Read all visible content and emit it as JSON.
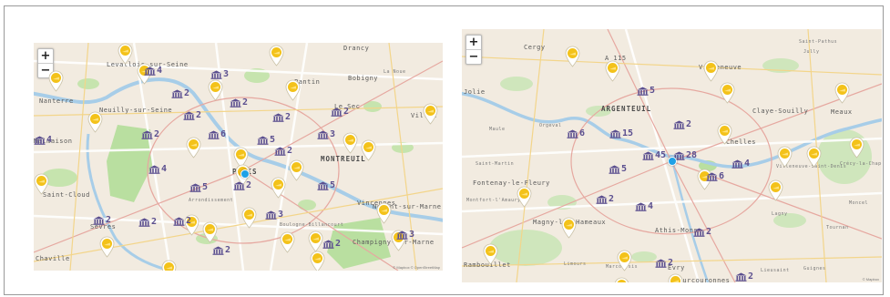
{
  "accent": {
    "marker_yellow": "#f3c21a",
    "museum_purple": "#5b4f8f",
    "you_dot": "#1ea1e6",
    "park_green": "#b9dfa0"
  },
  "zoom": {
    "in_label": "+",
    "out_label": "−"
  },
  "map1": {
    "places": [
      {
        "text": "Drancy",
        "cls": ""
      },
      {
        "text": "Bobigny",
        "cls": ""
      },
      {
        "text": "La Noue",
        "cls": "tiny"
      },
      {
        "text": "Pantin",
        "cls": ""
      },
      {
        "text": "Nanterre",
        "cls": ""
      },
      {
        "text": "Neuilly-sur-Seine",
        "cls": ""
      },
      {
        "text": "Levallois-sur-Seine",
        "cls": ""
      },
      {
        "text": "Malmaison",
        "cls": ""
      },
      {
        "text": "PARIS",
        "cls": "big"
      },
      {
        "text": "MONTREUIL",
        "cls": "big"
      },
      {
        "text": "Saint-Cloud",
        "cls": ""
      },
      {
        "text": "Sèvres",
        "cls": ""
      },
      {
        "text": "Chaville",
        "cls": ""
      },
      {
        "text": "Vincennes",
        "cls": ""
      },
      {
        "text": "Nogent-sur-Marne",
        "cls": ""
      },
      {
        "text": "Champigny-sur-Marne",
        "cls": ""
      },
      {
        "text": "Le Sec",
        "cls": ""
      },
      {
        "text": "Villem",
        "cls": ""
      },
      {
        "text": "Boulogne-Billancourt",
        "cls": "tiny"
      },
      {
        "text": "Arrondissement",
        "cls": "tiny"
      }
    ],
    "museums": [
      {
        "count": "4"
      },
      {
        "count": "3"
      },
      {
        "count": "2"
      },
      {
        "count": "2"
      },
      {
        "count": "2"
      },
      {
        "count": "2"
      },
      {
        "count": "2"
      },
      {
        "count": "2"
      },
      {
        "count": "6"
      },
      {
        "count": "5"
      },
      {
        "count": "3"
      },
      {
        "count": "2"
      },
      {
        "count": "4"
      },
      {
        "count": "4"
      },
      {
        "count": "5"
      },
      {
        "count": "2"
      },
      {
        "count": "5"
      },
      {
        "count": "2"
      },
      {
        "count": "2"
      },
      {
        "count": "2"
      },
      {
        "count": "3"
      },
      {
        "count": "2"
      },
      {
        "count": "2"
      },
      {
        "count": "3"
      }
    ],
    "pin_count": 26,
    "attribution": "© Mapbox © OpenStreetMap"
  },
  "map2": {
    "places": [
      {
        "text": "Cergy",
        "cls": ""
      },
      {
        "text": "A 115",
        "cls": ""
      },
      {
        "text": "Villeneuve",
        "cls": ""
      },
      {
        "text": "Saint-Pathus",
        "cls": "tiny"
      },
      {
        "text": "Jully",
        "cls": "tiny"
      },
      {
        "text": "Jolie",
        "cls": ""
      },
      {
        "text": "ARGENTEUIL",
        "cls": "big"
      },
      {
        "text": "Claye-Souilly",
        "cls": ""
      },
      {
        "text": "Meaux",
        "cls": ""
      },
      {
        "text": "Maule",
        "cls": "tiny"
      },
      {
        "text": "Orgeval",
        "cls": "tiny"
      },
      {
        "text": "Chelles",
        "cls": ""
      },
      {
        "text": "Saint-Martin",
        "cls": "tiny"
      },
      {
        "text": "Fontenay-le-Fleury",
        "cls": ""
      },
      {
        "text": "Villeneuve-Saint-Denis",
        "cls": "tiny"
      },
      {
        "text": "Crécy-la-Chapelle",
        "cls": "tiny"
      },
      {
        "text": "Montfort-l'Amaury",
        "cls": "tiny"
      },
      {
        "text": "Magny-les-Hameaux",
        "cls": ""
      },
      {
        "text": "Athis-Mons",
        "cls": ""
      },
      {
        "text": "Lagny",
        "cls": "tiny"
      },
      {
        "text": "Tournan",
        "cls": "tiny"
      },
      {
        "text": "Rambouillet",
        "cls": ""
      },
      {
        "text": "Limours",
        "cls": "tiny"
      },
      {
        "text": "Marcoussis",
        "cls": "tiny"
      },
      {
        "text": "Evry",
        "cls": ""
      },
      {
        "text": "Courcouronnes",
        "cls": ""
      },
      {
        "text": "Lieusaint",
        "cls": "tiny"
      },
      {
        "text": "Guignes",
        "cls": "tiny"
      },
      {
        "text": "Moncel",
        "cls": "tiny"
      }
    ],
    "museums": [
      {
        "count": "5"
      },
      {
        "count": "2"
      },
      {
        "count": "6"
      },
      {
        "count": "15"
      },
      {
        "count": "45"
      },
      {
        "count": "28"
      },
      {
        "count": "4"
      },
      {
        "count": "5"
      },
      {
        "count": "6"
      },
      {
        "count": "2"
      },
      {
        "count": "4"
      },
      {
        "count": "2"
      },
      {
        "count": "2"
      },
      {
        "count": "2"
      }
    ],
    "pin_count": 17,
    "attribution": "© Mapbox"
  }
}
